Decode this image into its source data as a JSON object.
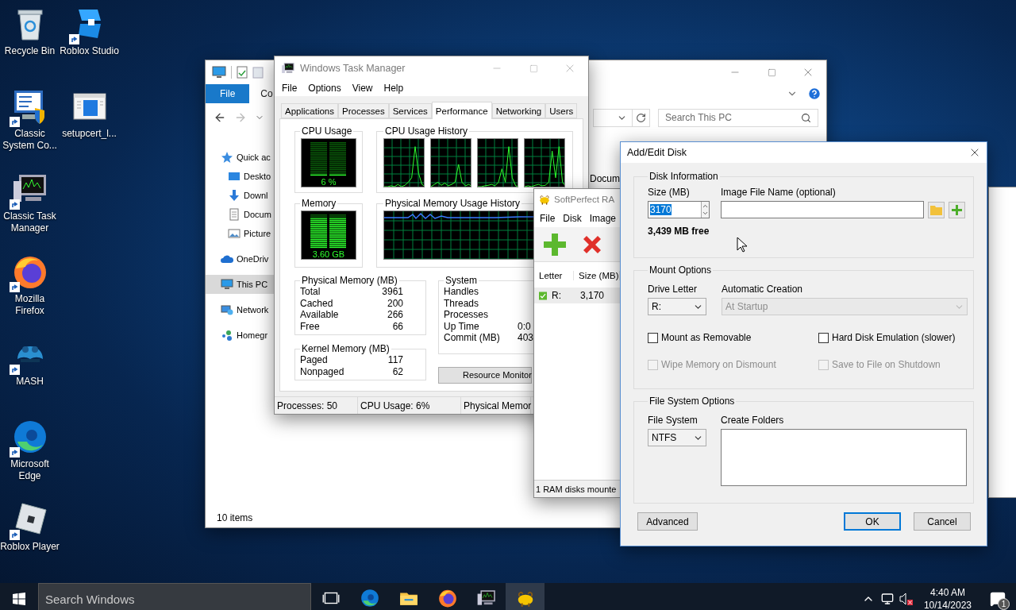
{
  "desktop_icons": [
    {
      "label": "Recycle Bin",
      "kind": "recycle_bin",
      "shortcut": false
    },
    {
      "label": "Classic System Co...",
      "kind": "control_panel",
      "shortcut": true
    },
    {
      "label": "Classic Task Manager",
      "kind": "task_manager",
      "shortcut": true
    },
    {
      "label": "Mozilla Firefox",
      "kind": "firefox",
      "shortcut": true
    },
    {
      "label": "MASH",
      "kind": "mash",
      "shortcut": true
    },
    {
      "label": "Microsoft Edge",
      "kind": "edge",
      "shortcut": true
    },
    {
      "label": "Roblox Player",
      "kind": "roblox_player",
      "shortcut": true
    },
    {
      "label": "Roblox Studio",
      "kind": "roblox_studio",
      "shortcut": true
    },
    {
      "label": "setupcert_l...",
      "kind": "setup_file",
      "shortcut": false
    }
  ],
  "explorer": {
    "ribbon_tabs": [
      {
        "label": "File",
        "selected": true
      },
      {
        "label": "Co",
        "selected": false
      }
    ],
    "search": {
      "placeholder": "Search This PC"
    },
    "sidebar": [
      {
        "label": "Quick ac",
        "kind": "star",
        "selected": false,
        "children": [
          {
            "label": "Deskto",
            "kind": "desktop",
            "selected": false
          },
          {
            "label": "Downl",
            "kind": "download",
            "selected": false
          },
          {
            "label": "Docum",
            "kind": "document",
            "selected": false
          },
          {
            "label": "Picture",
            "kind": "pictures",
            "selected": false
          }
        ]
      },
      {
        "label": "OneDriv",
        "kind": "cloud",
        "selected": false
      },
      {
        "label": "This PC",
        "kind": "pc",
        "selected": true
      },
      {
        "label": "Network",
        "kind": "network",
        "selected": false
      },
      {
        "label": "Homegr",
        "kind": "homegroup",
        "selected": false
      }
    ],
    "content_items": [
      "Docum"
    ],
    "status": "10 items"
  },
  "task_manager": {
    "title": "Windows Task Manager",
    "menu": [
      "File",
      "Options",
      "View",
      "Help"
    ],
    "tabs": [
      {
        "label": "Applications",
        "selected": false
      },
      {
        "label": "Processes",
        "selected": false
      },
      {
        "label": "Services",
        "selected": false
      },
      {
        "label": "Performance",
        "selected": true
      },
      {
        "label": "Networking",
        "selected": false
      },
      {
        "label": "Users",
        "selected": false
      }
    ],
    "cpu_usage": {
      "title": "CPU Usage",
      "reading": "6 %",
      "level": 0.06
    },
    "cpu_history": {
      "title": "CPU Usage History"
    },
    "memory": {
      "title": "Memory",
      "reading": "3.60 GB",
      "level": 0.91
    },
    "memory_history": {
      "title": "Physical Memory Usage History"
    },
    "physical_memory": {
      "title": "Physical Memory (MB)",
      "rows": [
        {
          "label": "Total",
          "value": "3961"
        },
        {
          "label": "Cached",
          "value": "200"
        },
        {
          "label": "Available",
          "value": "266"
        },
        {
          "label": "Free",
          "value": "66"
        }
      ]
    },
    "system": {
      "title": "System",
      "rows": [
        {
          "label": "Handles"
        },
        {
          "label": "Threads"
        },
        {
          "label": "Processes"
        },
        {
          "label": "Up Time",
          "value": "0:0"
        },
        {
          "label": "Commit (MB)",
          "value": "403"
        }
      ]
    },
    "kernel_memory": {
      "title": "Kernel Memory (MB)",
      "rows": [
        {
          "label": "Paged",
          "value": "117"
        },
        {
          "label": "Nonpaged",
          "value": "62"
        }
      ]
    },
    "resource_button": "Resource Monitor",
    "status": [
      "Processes: 50",
      "CPU Usage: 6%",
      "Physical Memor"
    ]
  },
  "ram_disk": {
    "title": "SoftPerfect RA",
    "menu": [
      "File",
      "Disk",
      "Image"
    ],
    "columns": [
      "Letter",
      "Size (MB)"
    ],
    "rows": [
      {
        "letter": "R:",
        "size": "3,170",
        "mounted": true
      }
    ],
    "status": "1 RAM disks mounte"
  },
  "dialog": {
    "title": "Add/Edit Disk",
    "disk_info": {
      "title": "Disk Information",
      "size_label": "Size (MB)",
      "size_value": "3170",
      "size_highlighted": true,
      "image_label": "Image File Name (optional)",
      "free": "3,439 MB free"
    },
    "mount": {
      "title": "Mount Options",
      "drive_label": "Drive Letter",
      "drive_value": "R:",
      "auto_label": "Automatic Creation",
      "auto_value": "At Startup",
      "auto_disabled": true,
      "options": [
        {
          "label": "Mount as Removable",
          "checked": false,
          "disabled": false
        },
        {
          "label": "Hard Disk Emulation (slower)",
          "checked": false,
          "disabled": false
        },
        {
          "label": "Wipe Memory on Dismount",
          "checked": false,
          "disabled": true
        },
        {
          "label": "Save to File on Shutdown",
          "checked": false,
          "disabled": true
        }
      ]
    },
    "file_system": {
      "title": "File System Options",
      "fs_label": "File System",
      "fs_value": "NTFS",
      "folders_label": "Create Folders"
    },
    "buttons": [
      {
        "label": "Advanced",
        "default": false
      },
      {
        "label": "OK",
        "default": true
      },
      {
        "label": "Cancel",
        "default": false
      }
    ]
  },
  "taskbar": {
    "search": {
      "placeholder": "Search Windows"
    },
    "apps": [
      {
        "kind": "task_view",
        "active": false
      },
      {
        "kind": "edge",
        "active": false
      },
      {
        "kind": "file_explorer",
        "active": false
      },
      {
        "kind": "firefox",
        "active": false
      },
      {
        "kind": "task_manager",
        "active": false
      },
      {
        "kind": "ram_disk",
        "active": true
      }
    ],
    "time": "4:40 AM",
    "date": "10/14/2023",
    "notifications": "1"
  }
}
